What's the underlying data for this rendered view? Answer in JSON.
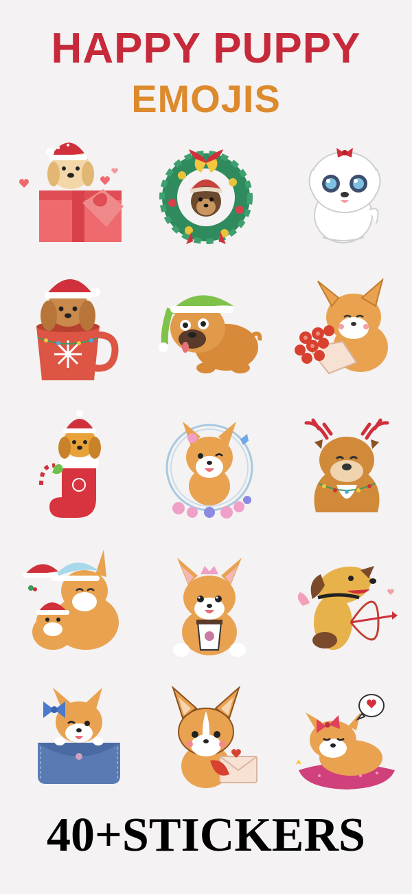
{
  "header": {
    "line1": "HAPPY PUPPY",
    "line2": "EMOJIS",
    "line1_color": "#c62a3a",
    "line2_color": "#dd8a2e"
  },
  "stickers": [
    {
      "icon": "puppy-gift-box-sticker",
      "theme": "golden retriever in santa hat inside pink gift box"
    },
    {
      "icon": "puppy-christmas-wreath-sticker",
      "theme": "yorkie in red hat inside green wreath with bells"
    },
    {
      "icon": "white-puppy-bow-sticker",
      "theme": "white fluffy puppy with red bow"
    },
    {
      "icon": "puppy-mug-sticker",
      "theme": "poodle in santa hat inside red mug"
    },
    {
      "icon": "pug-elf-hat-sticker",
      "theme": "brown pug with green elf hat"
    },
    {
      "icon": "corgi-roses-sticker",
      "theme": "corgi holding rose bouquet"
    },
    {
      "icon": "puppy-stocking-sticker",
      "theme": "puppy in red christmas stocking"
    },
    {
      "icon": "corgi-flower-wreath-sticker",
      "theme": "corgi in flower wreath with butterfly"
    },
    {
      "icon": "bulldog-reindeer-sticker",
      "theme": "bulldog with reindeer antlers and lights"
    },
    {
      "icon": "corgi-hug-sticker",
      "theme": "two corgis hugging in santa hats"
    },
    {
      "icon": "corgi-coffee-sticker",
      "theme": "corgi with crown holding coffee cup"
    },
    {
      "icon": "cupid-dog-sticker",
      "theme": "dog with wings and bow and arrow"
    },
    {
      "icon": "corgi-pocket-sticker",
      "theme": "corgi with bow in denim pocket"
    },
    {
      "icon": "corgi-letter-sticker",
      "theme": "corgi holding love letter"
    },
    {
      "icon": "corgi-pillow-sticker",
      "theme": "sleeping corgi on pink pillow with heart bubble"
    }
  ],
  "colors": {
    "background": "#f4f2f2",
    "footer_text": "#000000"
  },
  "footer": {
    "label": "40+STICKERS"
  }
}
